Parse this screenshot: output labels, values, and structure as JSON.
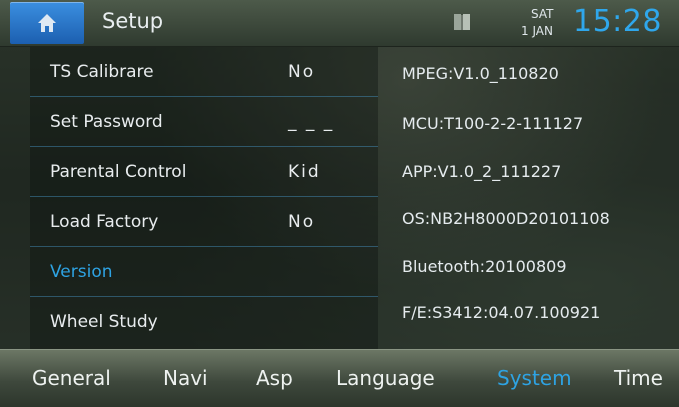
{
  "header": {
    "title": "Setup",
    "day": "SAT",
    "date": "1 JAN",
    "time": "15:28",
    "home_icon": "home-icon",
    "book_icon": "book-icon",
    "accent_color": "#2fa7ec"
  },
  "menu": {
    "items": [
      {
        "label": "TS Calibrare",
        "value": "No"
      },
      {
        "label": "Set Password",
        "value": "_ _ _"
      },
      {
        "label": "Parental Control",
        "value": "Kid"
      },
      {
        "label": "Load Factory",
        "value": "No"
      },
      {
        "label": "Version",
        "value": ""
      },
      {
        "label": "Wheel Study",
        "value": ""
      }
    ],
    "active_item": "Version"
  },
  "version_info": [
    "MPEG:V1.0_110820",
    "MCU:T100-2-2-111127",
    "APP:V1.0_2_111227",
    "OS:NB2H8000D20101108",
    "Bluetooth:20100809",
    "F/E:S3412:04.07.100921"
  ],
  "tabs": {
    "items": [
      "General",
      "Navi",
      "Asp",
      "Language",
      "System",
      "Time"
    ],
    "active": "System"
  }
}
